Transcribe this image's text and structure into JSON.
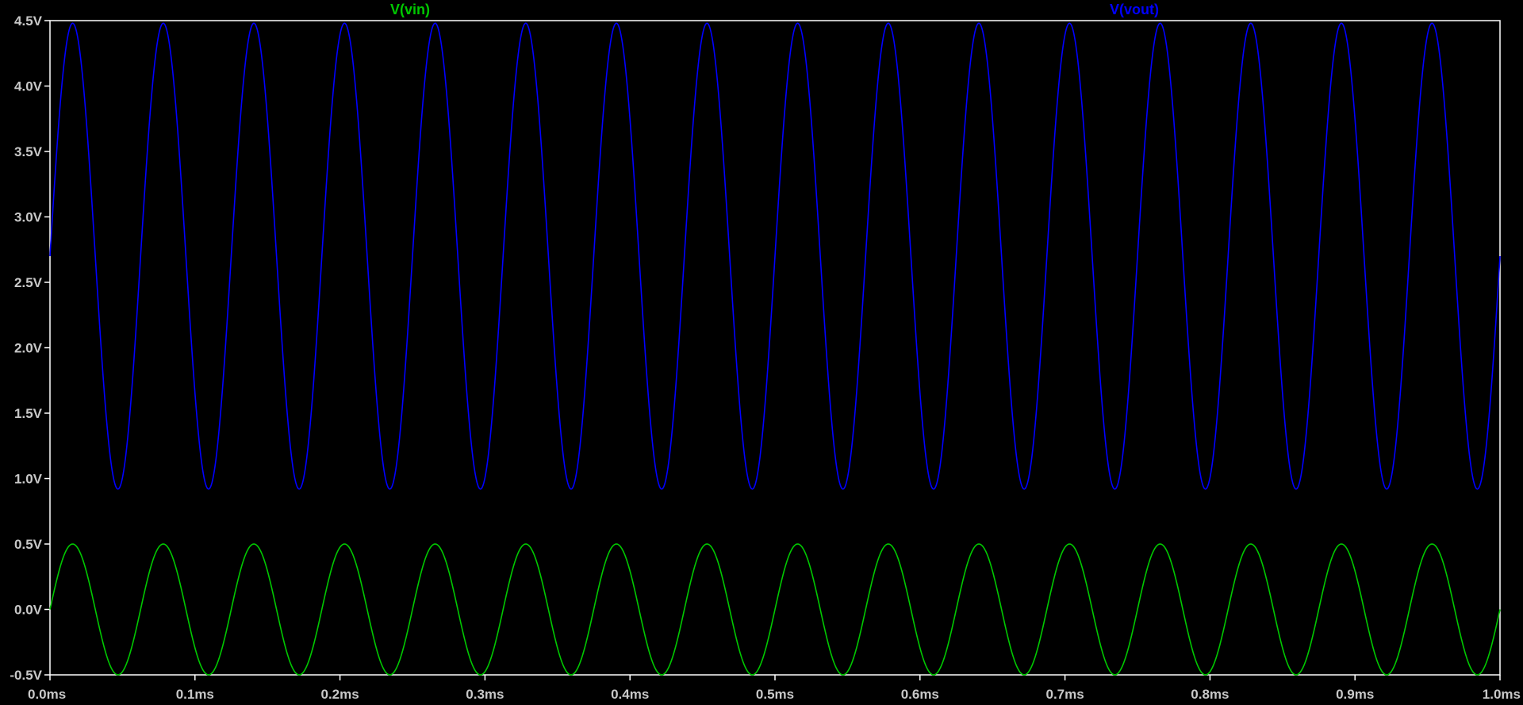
{
  "chart_data": {
    "type": "line",
    "title": "",
    "xlabel": "",
    "ylabel": "",
    "xlim": [
      0,
      1.0
    ],
    "ylim": [
      -0.5,
      4.5
    ],
    "grid": false,
    "background": "#000000",
    "axis_color": "#ffffff",
    "tick_label_color": "#c8c8c8",
    "x_ticks": [
      0.0,
      0.1,
      0.2,
      0.3,
      0.4,
      0.5,
      0.6,
      0.7,
      0.8,
      0.9,
      1.0
    ],
    "x_tick_labels": [
      "0.0ms",
      "0.1ms",
      "0.2ms",
      "0.3ms",
      "0.4ms",
      "0.5ms",
      "0.6ms",
      "0.7ms",
      "0.8ms",
      "0.9ms",
      "1.0ms"
    ],
    "y_ticks": [
      4.5,
      4.0,
      3.5,
      3.0,
      2.5,
      2.0,
      1.5,
      1.0,
      0.5,
      0.0,
      -0.5
    ],
    "y_tick_labels": [
      "4.5V",
      "4.0V",
      "3.5V",
      "3.0V",
      "2.5V",
      "2.0V",
      "1.5V",
      "1.0V",
      "0.5V",
      "0.0V",
      "-0.5V"
    ],
    "series": [
      {
        "name": "V(vin)",
        "color": "#00c800",
        "legend_position": "top-left",
        "waveform": "sine",
        "offset_v": 0.0,
        "amplitude_v": 0.5,
        "frequency_khz": 16,
        "phase_deg": 0
      },
      {
        "name": "V(vout)",
        "color": "#0000ff",
        "legend_position": "top-right",
        "waveform": "sine",
        "offset_v": 2.7,
        "amplitude_v": 1.78,
        "frequency_khz": 16,
        "phase_deg": 0
      }
    ]
  }
}
